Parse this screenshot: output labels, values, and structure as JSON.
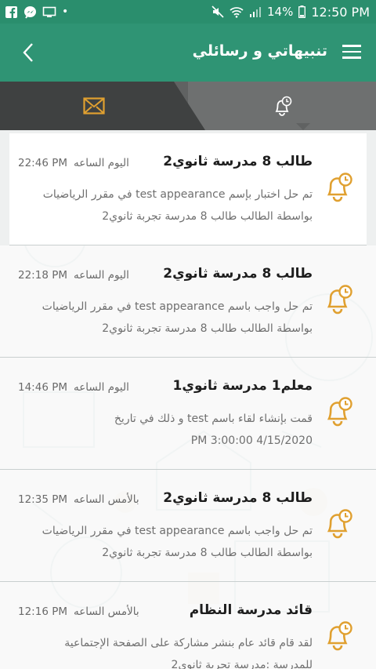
{
  "status_bar": {
    "battery": "14%",
    "time": "12:50 PM"
  },
  "app_bar": {
    "title": "تنبيهاتي و رسائلي"
  },
  "tabs": [
    {
      "name": "messages",
      "icon": "envelope-icon",
      "active": false
    },
    {
      "name": "notifications",
      "icon": "bell-clock-icon",
      "active": true
    }
  ],
  "colors": {
    "status_bar": "#2a8e6d",
    "app_bar": "#2f9474",
    "tab_bar": "#606262",
    "icon_accent": "#e0a030"
  },
  "notifications": [
    {
      "title": "طالب 8 مدرسة ثانوي2",
      "day": "اليوم الساعه",
      "time": "22:46 PM",
      "line1": "تم حل اختبار بإسم test appearance في مقرر الرياضيات",
      "line2": "بواسطة الطالب طالب 8 مدرسة تجربة ثانوي2"
    },
    {
      "title": "طالب 8 مدرسة ثانوي2",
      "day": "اليوم الساعه",
      "time": "22:18 PM",
      "line1": "تم حل واجب باسم test appearance في مقرر الرياضيات",
      "line2": "بواسطة الطالب طالب 8 مدرسة تجربة ثانوي2"
    },
    {
      "title": "معلم1 مدرسة ثانوي1",
      "day": "اليوم الساعه",
      "time": "14:46 PM",
      "line1": "قمت بإنشاء لقاء باسم test و ذلك في تاريخ",
      "line2": "4/15/2020 3:00:00 PM"
    },
    {
      "title": "طالب 8 مدرسة ثانوي2",
      "day": "بالأمس الساعه",
      "time": "12:35 PM",
      "line1": "تم حل واجب باسم test appearance في مقرر الرياضيات",
      "line2": "بواسطة الطالب طالب 8 مدرسة تجربة ثانوي2"
    },
    {
      "title": "قائد مدرسة النظام",
      "day": "بالأمس الساعه",
      "time": "12:16 PM",
      "line1": "لقد قام قائد عام بنشر مشاركة على الصفحة الإجتماعية",
      "line2": "للمدرسة :مدرسة تجربة ثانوي2"
    }
  ]
}
